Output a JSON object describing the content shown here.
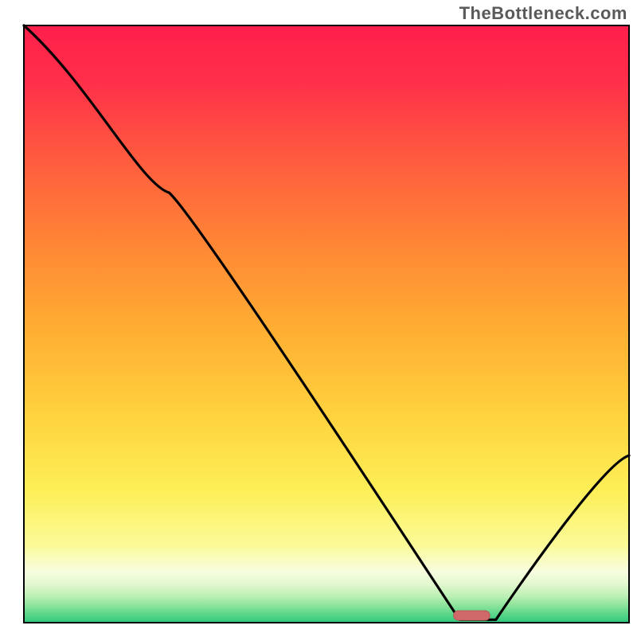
{
  "attribution": "TheBottleneck.com",
  "colors": {
    "frame": "#000000",
    "curve": "#000000",
    "marker_fill": "#d06a6a",
    "marker_stroke": "#b85555",
    "gradient_top": "#ff1744",
    "gradient_mid1": "#ff5e3a",
    "gradient_mid2": "#ffa726",
    "gradient_mid3": "#ffd54f",
    "gradient_mid4": "#fff176",
    "gradient_mid5": "#f9fbe7",
    "gradient_green1": "#d4f7c5",
    "gradient_green2": "#8be38a",
    "gradient_green3": "#4ad27a",
    "gradient_bottom": "#22c07a"
  },
  "chart_data": {
    "type": "line",
    "title": "",
    "xlabel": "",
    "ylabel": "",
    "xlim": [
      0,
      100
    ],
    "ylim": [
      0,
      100
    ],
    "x": [
      0,
      24,
      72,
      78,
      100
    ],
    "values": [
      104,
      72,
      0.5,
      0.5,
      28
    ],
    "marker": {
      "x_center": 74,
      "y": 1.2,
      "width": 6,
      "height": 1.6
    },
    "grid": false,
    "legend": null,
    "notes": "Axes have no visible tick labels; values are normalized 0–100 on each axis, estimated from the figure."
  }
}
